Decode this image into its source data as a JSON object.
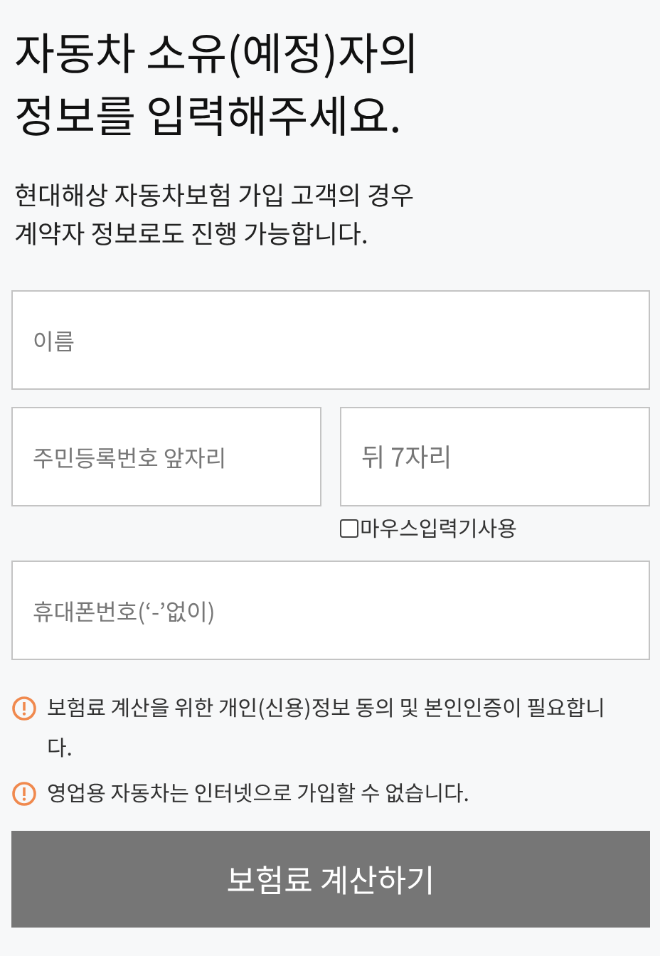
{
  "title_lines": [
    "자동차 소유(예정)자의",
    "정보를 입력해주세요."
  ],
  "subtitle_lines": [
    "현대해상 자동차보험 가입 고객의 경우",
    "계약자 정보로도 진행 가능합니다."
  ],
  "name_field": {
    "placeholder": "이름"
  },
  "id_front_field": {
    "placeholder": "주민등록번호 앞자리"
  },
  "id_back_field": {
    "placeholder": "뒤 7자리"
  },
  "mouse_input": {
    "label": "마우스입력기사용",
    "checked": false
  },
  "phone_field": {
    "placeholder": "휴대폰번호(‘-’없이)"
  },
  "notices": [
    "보험료 계산을 위한 개인(신용)정보 동의 및 본인인증이 필요합니다.",
    "영업용 자동차는 인터넷으로 가입할 수 없습니다."
  ],
  "submit_button": "보험료 계산하기"
}
